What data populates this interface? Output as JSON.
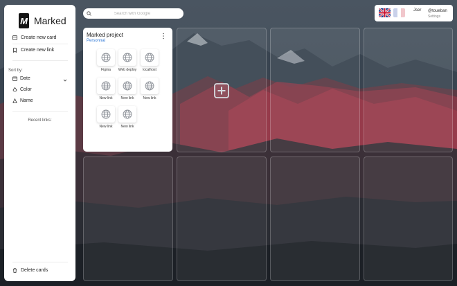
{
  "app": {
    "name": "Marked",
    "logo_letter": "M"
  },
  "sidebar": {
    "create_card": "Create new card",
    "create_link": "Create new link",
    "sort_label": "Sort by:",
    "sort_options": [
      "Date",
      "Color",
      "Name"
    ],
    "recent_label": "Recent links:",
    "delete_cards": "Delete cards"
  },
  "search": {
    "placeholder": "Search with Google"
  },
  "user": {
    "name": "Jser",
    "handle": "@toueban",
    "settings": "Settings"
  },
  "card": {
    "title": "Marked project",
    "subtitle": "Personnal",
    "links": [
      {
        "label": "Figma"
      },
      {
        "label": "Web deploy"
      },
      {
        "label": "localhost"
      },
      {
        "label": "New link"
      },
      {
        "label": "New link"
      },
      {
        "label": "New link"
      },
      {
        "label": "New link"
      },
      {
        "label": "New link"
      }
    ]
  },
  "colors": {
    "accent": "#2f78d6",
    "sidebar_bg": "#ffffff"
  },
  "icons": [
    "logo-icon",
    "card-icon",
    "bookmark-icon",
    "calendar-icon",
    "color-icon",
    "name-icon",
    "trash-icon",
    "search-icon",
    "globe-icon",
    "plus-icon",
    "kebab-icon"
  ]
}
